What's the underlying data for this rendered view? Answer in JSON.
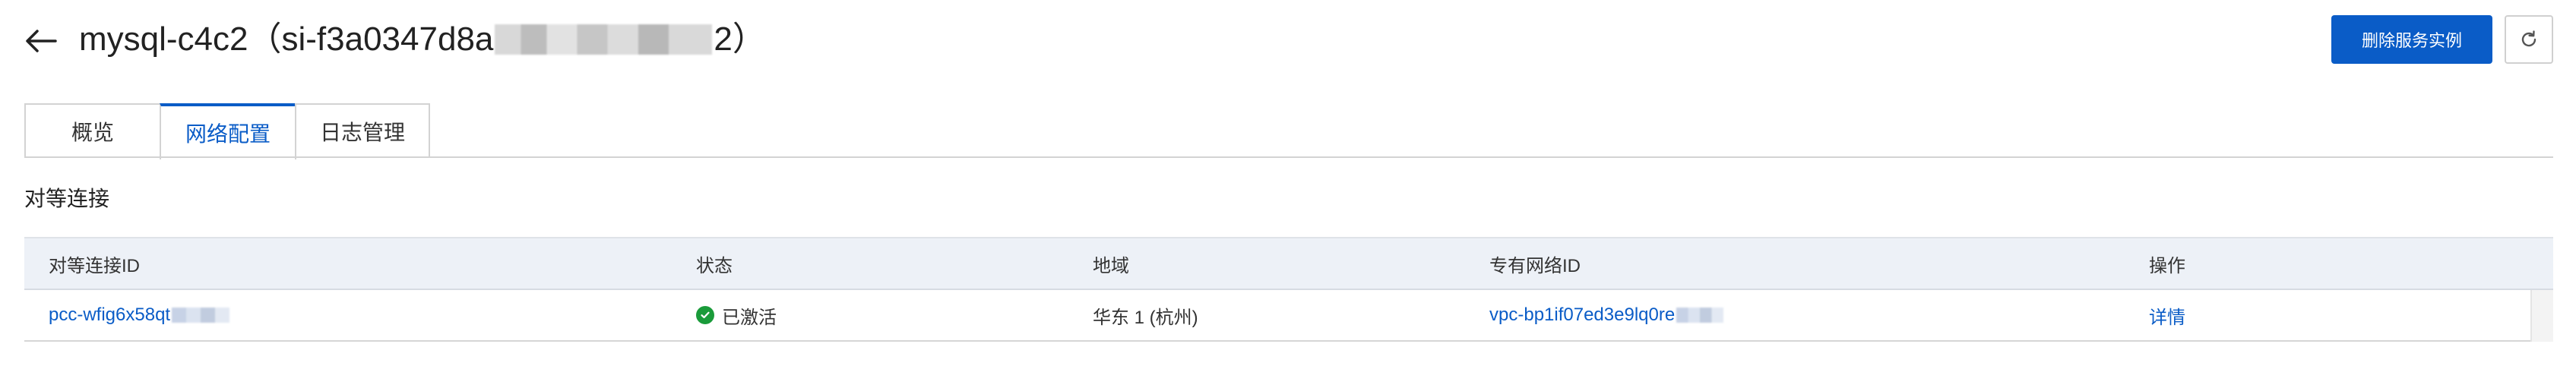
{
  "header": {
    "title_main": "mysql-c4c2（si-f3a0347d8a",
    "title_end": "2）",
    "delete_button": "删除服务实例"
  },
  "tabs": [
    {
      "label": "概览",
      "active": false
    },
    {
      "label": "网络配置",
      "active": true
    },
    {
      "label": "日志管理",
      "active": false
    }
  ],
  "section": {
    "title": "对等连接"
  },
  "table": {
    "columns": [
      "对等连接ID",
      "状态",
      "地域",
      "专有网络ID",
      "操作"
    ],
    "rows": [
      {
        "peer_id": "pcc-wfig6x58qt",
        "status": "已激活",
        "region": "华东 1 (杭州)",
        "vpc_id": "vpc-bp1if07ed3e9lq0re",
        "action": "详情"
      }
    ]
  },
  "colors": {
    "accent": "#0a5cc7",
    "status_active": "#1a9b3a"
  },
  "icons": {
    "back": "arrow-left-icon",
    "refresh": "refresh-icon",
    "status": "check-circle-icon"
  }
}
